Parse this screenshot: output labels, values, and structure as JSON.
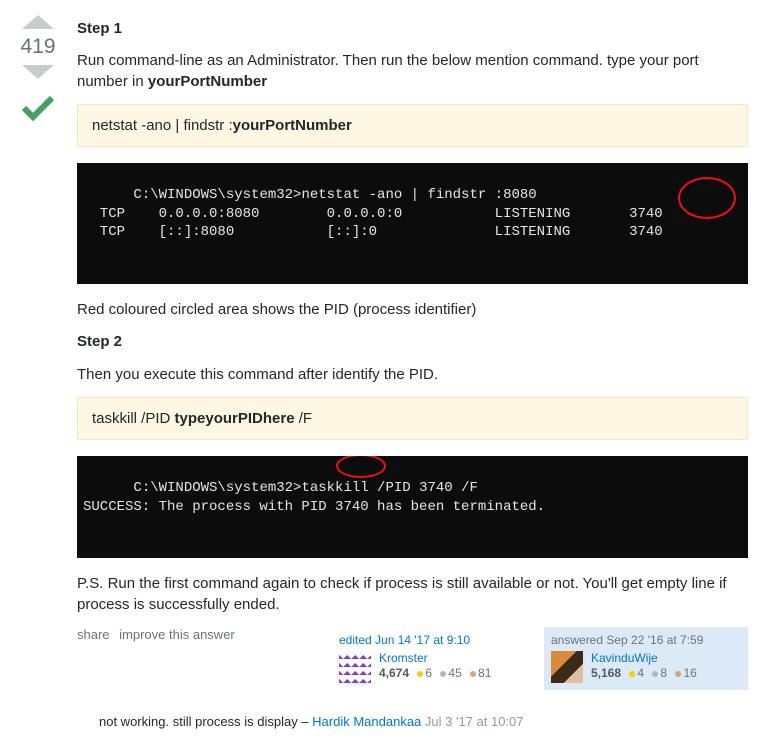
{
  "vote": {
    "score": "419"
  },
  "body": {
    "step1_heading": "Step 1",
    "step1_p_a": "Run command-line as an Administrator. Then run the below mention command. type your port number in ",
    "step1_p_b": "yourPortNumber",
    "cmd1_a": "netstat -ano | findstr :",
    "cmd1_b": "yourPortNumber",
    "term1_text": "C:\\WINDOWS\\system32>netstat -ano | findstr :8080\n  TCP    0.0.0.0:8080        0.0.0.0:0           LISTENING       3740\n  TCP    [::]:8080           [::]:0              LISTENING       3740",
    "red_note": "Red coloured circled area shows the PID (process identifier)",
    "step2_heading": "Step 2",
    "step2_p": "Then you execute this command after identify the PID.",
    "cmd2_a": "taskkill /PID ",
    "cmd2_b": "typeyourPIDhere",
    "cmd2_c": " /F",
    "term2_text": "C:\\WINDOWS\\system32>taskkill /PID 3740 /F\nSUCCESS: The process with PID 3740 has been terminated.",
    "ps": "P.S. Run the first command again to check if process is still available or not. You'll get empty line if process is successfully ended."
  },
  "menu": {
    "share": "share",
    "improve": "improve this answer"
  },
  "editor": {
    "action": "edited Jun 14 '17 at 9:10",
    "name": "Kromster",
    "rep": "4,674",
    "gold": "6",
    "silver": "45",
    "bronze": "81"
  },
  "author": {
    "action": "answered Sep 22 '16 at 7:59",
    "name": "KavinduWije",
    "rep": "5,168",
    "gold": "4",
    "silver": "8",
    "bronze": "16"
  },
  "comment": {
    "text": "not working. still process is display – ",
    "author": "Hardik Mandankaa",
    "when": " Jul 3 '17 at 10:07"
  }
}
